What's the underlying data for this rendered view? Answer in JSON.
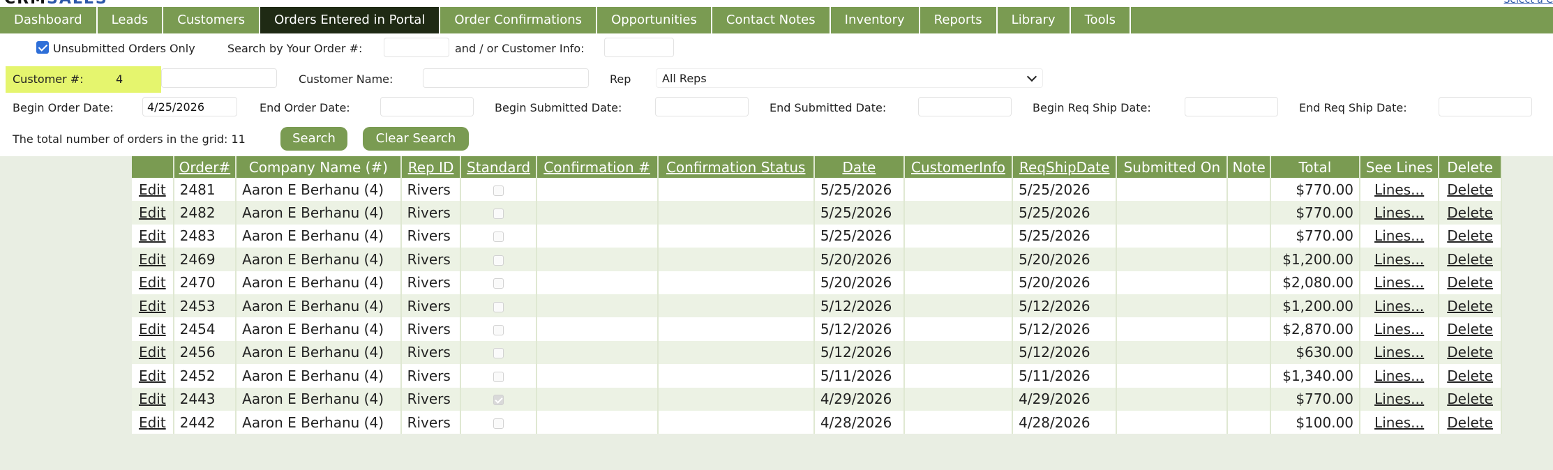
{
  "brand": {
    "logo_part1": "CRM",
    "logo_part2": "SALES",
    "select_link": "Select a C"
  },
  "nav": [
    {
      "label": "Dashboard",
      "active": false
    },
    {
      "label": "Leads",
      "active": false
    },
    {
      "label": "Customers",
      "active": false
    },
    {
      "label": "Orders Entered in Portal",
      "active": true
    },
    {
      "label": "Order Confirmations",
      "active": false
    },
    {
      "label": "Opportunities",
      "active": false
    },
    {
      "label": "Contact Notes",
      "active": false
    },
    {
      "label": "Inventory",
      "active": false
    },
    {
      "label": "Reports",
      "active": false
    },
    {
      "label": "Library",
      "active": false
    },
    {
      "label": "Tools",
      "active": false
    }
  ],
  "filters": {
    "unsubmitted_label": "Unsubmitted Orders Only",
    "unsubmitted_checked": true,
    "search_order_label": "Search by Your Order #:",
    "search_order_value": "",
    "customer_info_label": "and / or Customer Info:",
    "customer_info_value": "",
    "customer_num_label": "Customer #:",
    "customer_num_value": "4",
    "customer_name_label": "Customer Name:",
    "customer_name_value": "",
    "rep_label": "Rep",
    "rep_value": "All Reps",
    "begin_order_date_label": "Begin Order Date:",
    "begin_order_date_value": "4/25/2026",
    "end_order_date_label": "End Order Date:",
    "end_order_date_value": "",
    "begin_submitted_label": "Begin Submitted Date:",
    "begin_submitted_value": "",
    "end_submitted_label": "End Submitted Date:",
    "end_submitted_value": "",
    "begin_req_ship_label": "Begin Req Ship Date:",
    "begin_req_ship_value": "",
    "end_req_ship_label": "End Req Ship Date:",
    "end_req_ship_value": "",
    "total_text": "The total number of orders in the grid: 11",
    "search_button": "Search",
    "clear_button": "Clear Search"
  },
  "grid": {
    "columns": [
      {
        "label": "",
        "sortable": false
      },
      {
        "label": "Order#",
        "sortable": true
      },
      {
        "label": "Company Name (#)",
        "sortable": false
      },
      {
        "label": "Rep ID",
        "sortable": true
      },
      {
        "label": "Standard",
        "sortable": true
      },
      {
        "label": "Confirmation #",
        "sortable": true
      },
      {
        "label": "Confirmation Status",
        "sortable": true
      },
      {
        "label": "Date",
        "sortable": true
      },
      {
        "label": "CustomerInfo",
        "sortable": true
      },
      {
        "label": "ReqShipDate",
        "sortable": true
      },
      {
        "label": "Submitted On",
        "sortable": false
      },
      {
        "label": "Note",
        "sortable": false
      },
      {
        "label": "Total",
        "sortable": false
      },
      {
        "label": "See Lines",
        "sortable": false
      },
      {
        "label": "Delete",
        "sortable": false
      }
    ],
    "edit_label": "Edit",
    "lines_label": "Lines...",
    "delete_label": "Delete",
    "rows": [
      {
        "order": "2481",
        "company": "Aaron E Berhanu (4)",
        "rep": "Rivers",
        "standard": false,
        "conf_num": "",
        "conf_status": "",
        "date": "5/25/2026",
        "customer_info": "",
        "req_ship": "5/25/2026",
        "submitted": "",
        "note": "",
        "total": "$770.00"
      },
      {
        "order": "2482",
        "company": "Aaron E Berhanu (4)",
        "rep": "Rivers",
        "standard": false,
        "conf_num": "",
        "conf_status": "",
        "date": "5/25/2026",
        "customer_info": "",
        "req_ship": "5/25/2026",
        "submitted": "",
        "note": "",
        "total": "$770.00"
      },
      {
        "order": "2483",
        "company": "Aaron E Berhanu (4)",
        "rep": "Rivers",
        "standard": false,
        "conf_num": "",
        "conf_status": "",
        "date": "5/25/2026",
        "customer_info": "",
        "req_ship": "5/25/2026",
        "submitted": "",
        "note": "",
        "total": "$770.00"
      },
      {
        "order": "2469",
        "company": "Aaron E Berhanu (4)",
        "rep": "Rivers",
        "standard": false,
        "conf_num": "",
        "conf_status": "",
        "date": "5/20/2026",
        "customer_info": "",
        "req_ship": "5/20/2026",
        "submitted": "",
        "note": "",
        "total": "$1,200.00"
      },
      {
        "order": "2470",
        "company": "Aaron E Berhanu (4)",
        "rep": "Rivers",
        "standard": false,
        "conf_num": "",
        "conf_status": "",
        "date": "5/20/2026",
        "customer_info": "",
        "req_ship": "5/20/2026",
        "submitted": "",
        "note": "",
        "total": "$2,080.00"
      },
      {
        "order": "2453",
        "company": "Aaron E Berhanu (4)",
        "rep": "Rivers",
        "standard": false,
        "conf_num": "",
        "conf_status": "",
        "date": "5/12/2026",
        "customer_info": "",
        "req_ship": "5/12/2026",
        "submitted": "",
        "note": "",
        "total": "$1,200.00"
      },
      {
        "order": "2454",
        "company": "Aaron E Berhanu (4)",
        "rep": "Rivers",
        "standard": false,
        "conf_num": "",
        "conf_status": "",
        "date": "5/12/2026",
        "customer_info": "",
        "req_ship": "5/12/2026",
        "submitted": "",
        "note": "",
        "total": "$2,870.00"
      },
      {
        "order": "2456",
        "company": "Aaron E Berhanu (4)",
        "rep": "Rivers",
        "standard": false,
        "conf_num": "",
        "conf_status": "",
        "date": "5/12/2026",
        "customer_info": "",
        "req_ship": "5/12/2026",
        "submitted": "",
        "note": "",
        "total": "$630.00"
      },
      {
        "order": "2452",
        "company": "Aaron E Berhanu (4)",
        "rep": "Rivers",
        "standard": false,
        "conf_num": "",
        "conf_status": "",
        "date": "5/11/2026",
        "customer_info": "",
        "req_ship": "5/11/2026",
        "submitted": "",
        "note": "",
        "total": "$1,340.00"
      },
      {
        "order": "2443",
        "company": "Aaron E Berhanu (4)",
        "rep": "Rivers",
        "standard": true,
        "conf_num": "",
        "conf_status": "",
        "date": "4/29/2026",
        "customer_info": "",
        "req_ship": "4/29/2026",
        "submitted": "",
        "note": "",
        "total": "$770.00"
      },
      {
        "order": "2442",
        "company": "Aaron E Berhanu (4)",
        "rep": "Rivers",
        "standard": false,
        "conf_num": "",
        "conf_status": "",
        "date": "4/28/2026",
        "customer_info": "",
        "req_ship": "4/28/2026",
        "submitted": "",
        "note": "",
        "total": "$100.00"
      }
    ]
  },
  "colors": {
    "nav_green": "#7a9b52",
    "active_tab": "#1f2a14",
    "highlight_yellow": "#e5f56e",
    "page_bg": "#e9eee3"
  }
}
